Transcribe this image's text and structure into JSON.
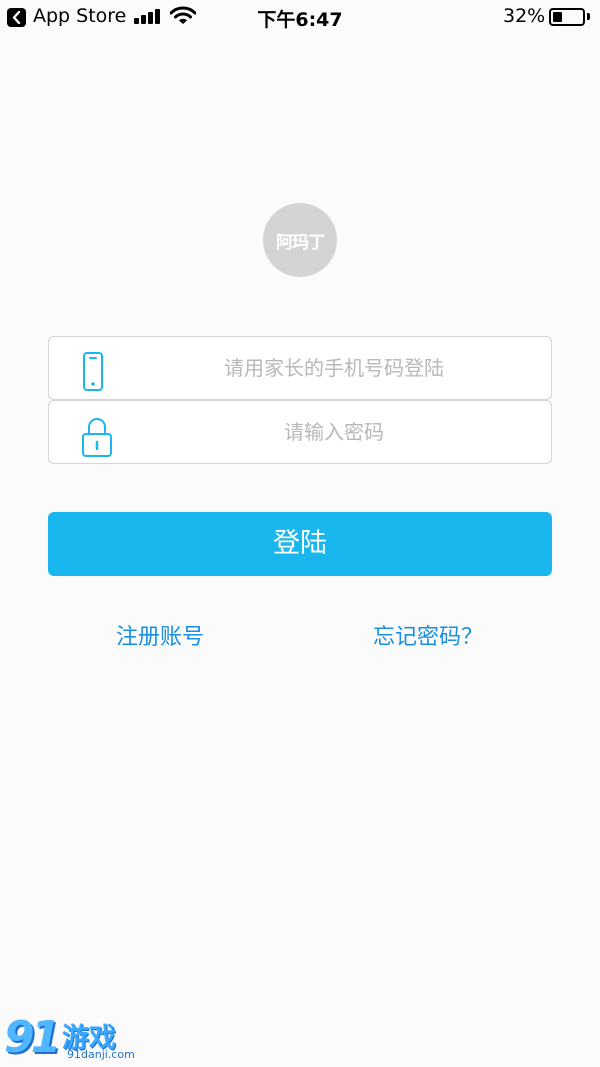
{
  "status_bar": {
    "back_app": "App Store",
    "time": "下午6:47",
    "battery_percent": "32%",
    "battery_level": 0.32,
    "icons": [
      "back-icon",
      "signal-icon",
      "wifi-icon",
      "battery-icon"
    ]
  },
  "logo": {
    "text": "阿玛丁",
    "color": "#d4d4d4"
  },
  "form": {
    "phone_placeholder": "请用家长的手机号码登陆",
    "phone_value": "",
    "password_placeholder": "请输入密码",
    "password_value": "",
    "phone_icon": "phone-icon",
    "password_icon": "lock-icon"
  },
  "login_button": {
    "label": "登陆",
    "color": "#1ab6ee"
  },
  "links": {
    "register": "注册账号",
    "forgot": "忘记密码？",
    "color": "#1a8fe0"
  },
  "watermark": {
    "number": "91",
    "text": "游戏",
    "url": "91danji.com"
  }
}
